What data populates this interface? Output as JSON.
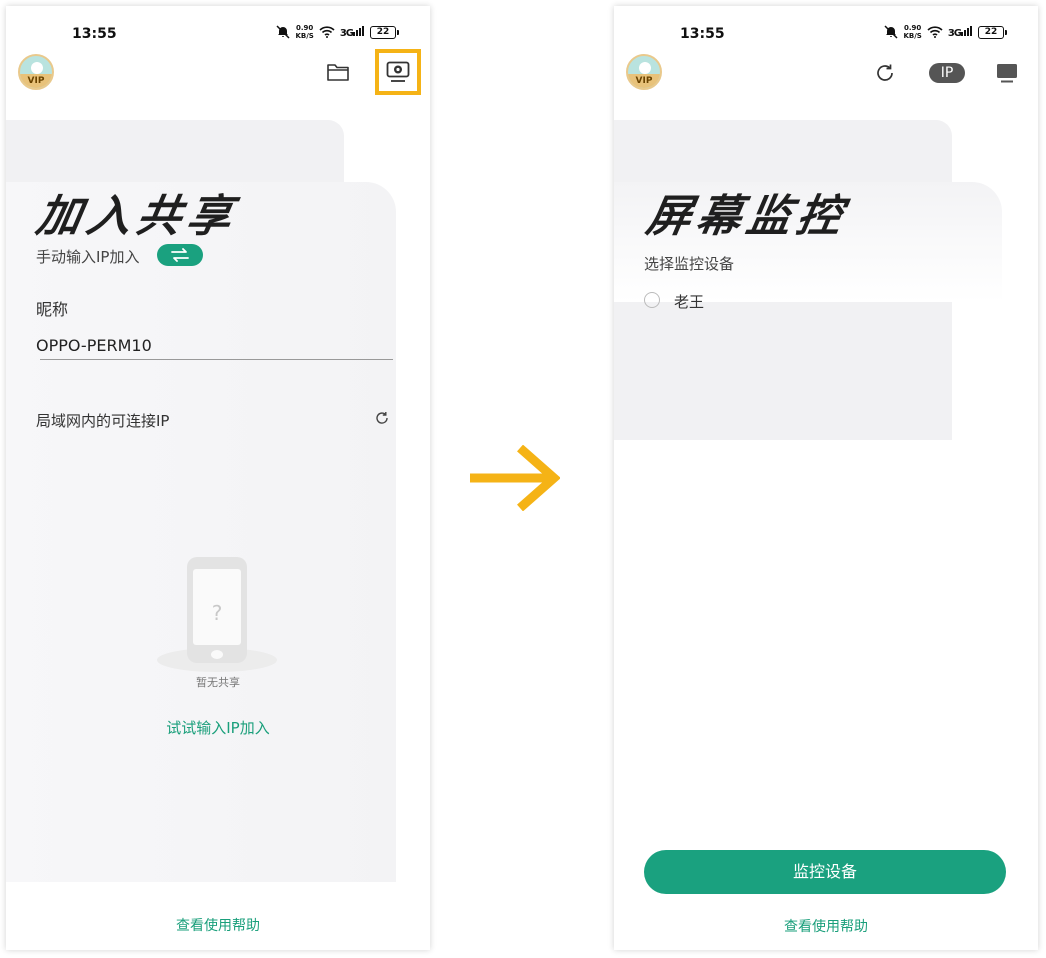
{
  "left": {
    "status": {
      "time": "13:55",
      "net_speed_value": "0.90",
      "net_speed_unit": "KB/S",
      "signal": "3G",
      "battery": "22"
    },
    "header": {
      "folder_icon": "folder-icon",
      "monitor_icon": "screen-monitor-icon",
      "highlight_color": "#f5b316"
    },
    "title": "加入共享",
    "manual_ip_label": "手动输入IP加入",
    "nickname_label": "昵称",
    "nickname_value": "OPPO-PERM10",
    "lan_ip_label": "局域网内的可连接IP",
    "empty_placeholder_glyph": "?",
    "empty_text": "暂无共享",
    "try_link": "试试输入IP加入",
    "help_link": "查看使用帮助"
  },
  "right": {
    "status": {
      "time": "13:55",
      "net_speed_value": "0.90",
      "net_speed_unit": "KB/S",
      "signal": "3G",
      "battery": "22"
    },
    "header": {
      "ip_badge": "IP"
    },
    "title": "屏幕监控",
    "select_label": "选择监控设备",
    "devices": [
      {
        "name": "老王",
        "selected": false
      }
    ],
    "primary_button": "监控设备",
    "help_link": "查看使用帮助"
  },
  "vip_label": "VIP",
  "colors": {
    "accent_green": "#1aa17f",
    "arrow": "#f5b316"
  }
}
